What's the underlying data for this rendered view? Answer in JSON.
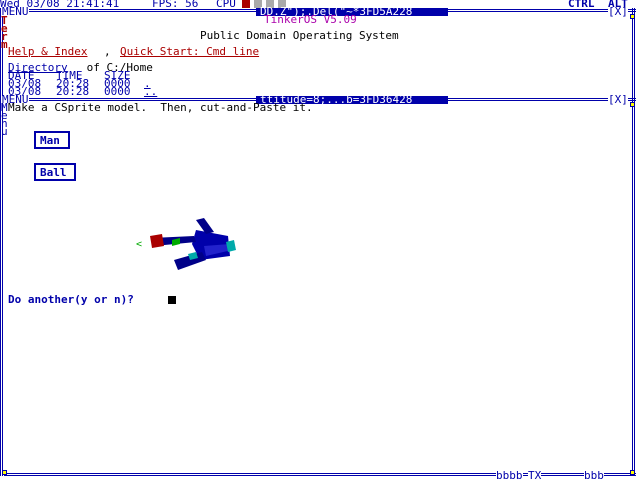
{
  "system_bar": {
    "datetime": "Wed 03/08 21:41:41",
    "fps": "FPS: 56",
    "cpu_label": "CPU",
    "ctrl": "CTRL",
    "alt": "ALT"
  },
  "term_window": {
    "menu": "MENU",
    "title": "DD.Z\");.Del(\"~*3FD5A228",
    "close": "[X]",
    "side_letters": [
      "T",
      "e",
      "r",
      "m"
    ],
    "os_name": "TinkerOS V5.09",
    "tagline": "Public Domain Operating System",
    "help_link": "Help & Index",
    "separator": ", ",
    "quickstart_link": "Quick Start: Cmd line",
    "dir_link": "Directory",
    "dir_of": " of C:/Home",
    "list_header": {
      "date": "DATE",
      "time": "TIME",
      "size": "SIZE"
    },
    "list_rows": [
      {
        "date": "03/08",
        "time": "20:28",
        "size": "0000",
        "name": "."
      },
      {
        "date": "03/08",
        "time": "20:28",
        "size": "0000",
        "name": ".."
      }
    ]
  },
  "model_window": {
    "menu": "MENU",
    "title": "ttitude=8;...b=3FD36428",
    "close": "[X]",
    "side_letters": [
      "M",
      "e",
      "n",
      "u"
    ],
    "prompt_line": "Make a CSprite model.  Then, cut-and-Paste it.",
    "buttons": [
      {
        "label": "Man"
      },
      {
        "label": "Ball"
      }
    ],
    "question": "Do another(y or n)? "
  },
  "bottom_bar": {
    "tasks": "bbbb",
    "tx": "TX",
    "tasks2": "bbb"
  },
  "colors": {
    "navy": "#0000aa",
    "red": "#aa0000",
    "purple": "#aa00aa",
    "yellow": "#ffff00",
    "cyan": "#00aaaa"
  }
}
